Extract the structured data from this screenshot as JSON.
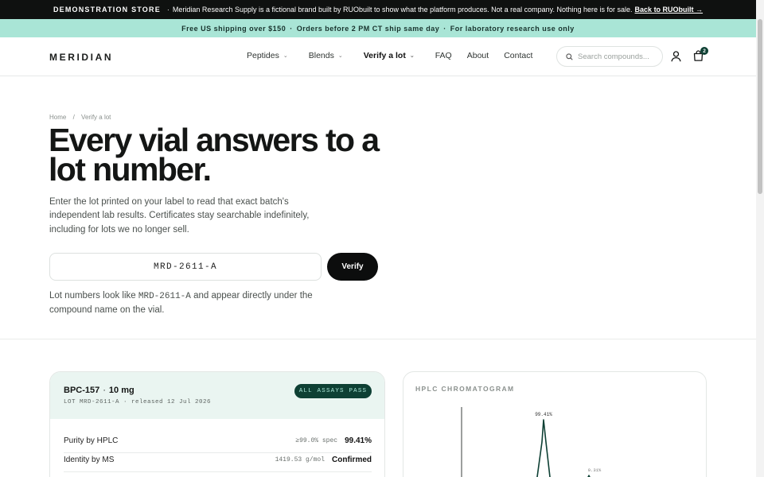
{
  "demo_banner": {
    "lead": "DEMONSTRATION STORE",
    "separator": "·",
    "message": "Meridian Research Supply is a fictional brand built by RUObuilt to show what the platform produces. Not a real company. Nothing here is for sale.",
    "link": "Back to RUObuilt →"
  },
  "promo_bar": {
    "items": [
      "Free US shipping over $150",
      "Orders before 2 PM CT ship same day",
      "For laboratory research use only"
    ],
    "separator": "·"
  },
  "header": {
    "logo": "MERIDIAN",
    "nav": [
      "Peptides",
      "Blends",
      "Verify a lot",
      "FAQ",
      "About",
      "Contact"
    ],
    "search_placeholder": "Search compounds...",
    "cart_count": "2",
    "icons": {
      "search": "search-icon",
      "account": "user-icon",
      "cart": "shopping-bag-icon",
      "dropdown": "chevron-down-icon"
    }
  },
  "breadcrumb": {
    "home": "Home",
    "separator": "/",
    "current": "Verify a lot"
  },
  "hero": {
    "title": "Every vial answers to a lot number.",
    "lead": "Enter the lot printed on your label to read that exact batch's independent lab results. Certificates stay searchable indefinitely, including for lots we no longer sell.",
    "lot_value": "MRD-2611-A",
    "verify_label": "Verify",
    "hint_before": "Lot numbers look like ",
    "hint_code": "MRD-2611-A",
    "hint_after": " and appear directly under the compound name on the vial."
  },
  "report": {
    "product": "BPC-157",
    "separator": "·",
    "dose": "10 mg",
    "lot_line": "LOT MRD-2611-A · released 12 Jul 2026",
    "status": "ALL ASSAYS PASS",
    "rows": [
      {
        "label": "Purity by HPLC",
        "spec": "≥99.0% spec",
        "value": "99.41%"
      },
      {
        "label": "Identity by MS",
        "spec": "1419.53 g/mol",
        "value": "Confirmed"
      }
    ]
  },
  "chromatogram": {
    "title": "HPLC CHROMATOGRAM",
    "main_peak_label": "99.41%",
    "minor_peak_label": "0.31%"
  },
  "colors": {
    "accent_dark": "#0e4034",
    "accent_mint": "#a9e5d6",
    "report_header_bg": "#eaf5f1",
    "chromatogram_line": "#0e4034"
  }
}
